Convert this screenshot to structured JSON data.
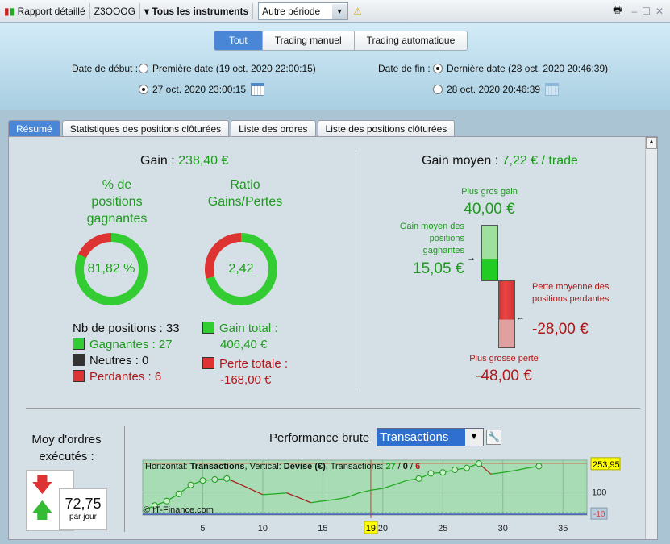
{
  "toolbar": {
    "report": "Rapport détaillé",
    "account": "Z3OOOG",
    "instruments": "Tous les instruments",
    "period": "Autre période"
  },
  "filters": {
    "seg": [
      "Tout",
      "Trading manuel",
      "Trading automatique"
    ],
    "start_label": "Date de début :",
    "start_first": "Première date (19 oct. 2020 22:00:15)",
    "start_custom": "27 oct. 2020 23:00:15",
    "end_label": "Date de fin :",
    "end_last": "Dernière date (28 oct. 2020 20:46:39)",
    "end_custom": "28 oct. 2020 20:46:39"
  },
  "tabs": [
    "Résumé",
    "Statistiques des positions clôturées",
    "Liste des ordres",
    "Liste des positions clôturées"
  ],
  "summary": {
    "gain_label": "Gain : ",
    "gain": "238,40 €",
    "pct_title": "% de positions gagnantes",
    "pct": "81,82 %",
    "pct_value": 81.82,
    "ratio_title": "Ratio Gains/Pertes",
    "ratio": "2,42",
    "ratio_fraction": 0.708,
    "nb": "Nb de positions : 33",
    "win": "Gagnantes : 27",
    "neutral": "Neutres : 0",
    "lose": "Perdantes : 6",
    "gain_total_label": "Gain total :",
    "gain_total": "406,40 €",
    "loss_total_label": "Perte totale :",
    "loss_total": "-168,00 €"
  },
  "average": {
    "label": "Gain moyen : ",
    "value": "7,22 € / trade",
    "max_gain_label": "Plus gros gain",
    "max_gain": "40,00 €",
    "avg_win_label": "Gain moyen des positions gagnantes",
    "avg_win": "15,05 €",
    "avg_loss_label": "Perte moyenne des positions perdantes",
    "avg_loss": "-28,00 €",
    "max_loss_label": "Plus grosse perte",
    "max_loss": "-48,00 €"
  },
  "orders": {
    "title": "Moy d'ordres exécutés :",
    "value": "72,75",
    "unit": "par jour"
  },
  "perf": {
    "title": "Performance brute",
    "mode": "Transactions"
  },
  "colors": {
    "accent": "#4a86d6",
    "green": "#1d9a1d",
    "red": "#b01818"
  },
  "chart_data": {
    "type": "line",
    "info_prefix": "Horizontal: ",
    "h": "Transactions",
    "info_mid": ", Vertical: ",
    "v": "Devise (€)",
    "info_tx": ", Transactions: ",
    "tx_win": "27",
    "tx_neutral": "0",
    "tx_lose": "6",
    "copyright": "© IT-Finance.com",
    "x": [
      0,
      1,
      2,
      3,
      4,
      5,
      6,
      7,
      8,
      9,
      10,
      11,
      12,
      13,
      14,
      15,
      16,
      17,
      18,
      19,
      20,
      21,
      22,
      23,
      24,
      25,
      26,
      27,
      28,
      29,
      30,
      31,
      32,
      33
    ],
    "y": [
      0,
      28,
      52,
      90,
      138,
      162,
      167,
      172,
      145,
      115,
      86,
      90,
      95,
      70,
      43,
      52,
      60,
      71,
      95,
      110,
      119,
      140,
      162,
      172,
      200,
      205,
      219,
      229,
      253,
      196,
      205,
      215,
      228,
      238.4
    ],
    "markers": [
      1,
      2,
      3,
      4,
      5,
      6,
      7,
      23,
      24,
      25,
      26,
      27,
      28,
      33
    ],
    "xticks": [
      "5",
      "10",
      "15",
      "20",
      "25",
      "30",
      "35"
    ],
    "xtick_values": [
      5,
      10,
      15,
      20,
      25,
      30,
      35
    ],
    "ytick": "100",
    "top_label": "253,95",
    "bottom_label": "-10",
    "cursor_label": "19",
    "xlim": [
      0,
      37
    ],
    "ylim": [
      -14,
      262
    ]
  }
}
